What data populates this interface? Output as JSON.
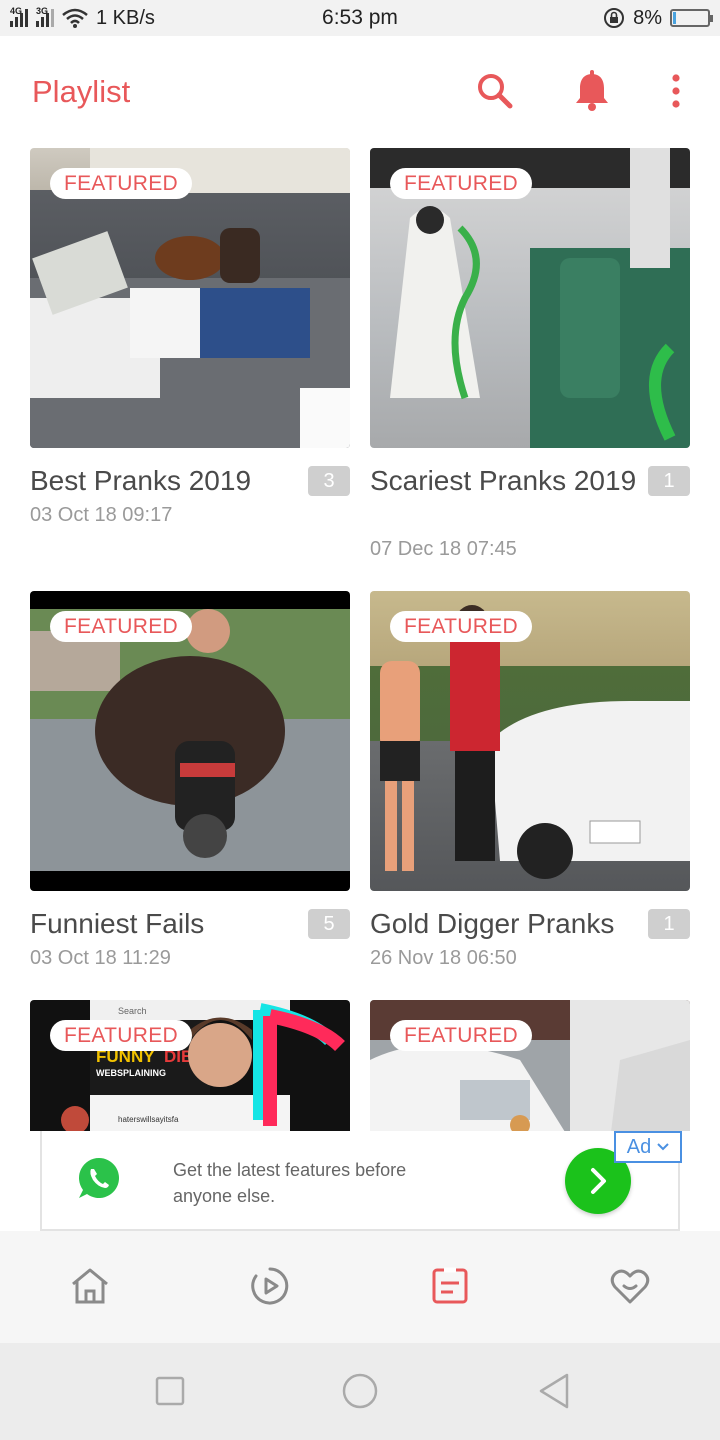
{
  "status_bar": {
    "network_1": "4G",
    "network_2": "3G",
    "speed": "1 KB/s",
    "time": "6:53 pm",
    "battery_percent": "8%",
    "battery_level": 0.08
  },
  "header": {
    "title": "Playlist",
    "search_icon": "search-icon",
    "bell_icon": "bell-icon",
    "more_icon": "more-vertical-icon",
    "accent_color": "#e8585a"
  },
  "playlists": [
    {
      "title": "Best Pranks 2019",
      "date": "03 Oct 18 09:17",
      "count": "3",
      "badge": "FEATURED"
    },
    {
      "title": "Scariest Pranks 2019",
      "date": "07 Dec 18 07:45",
      "count": "1",
      "badge": "FEATURED"
    },
    {
      "title": "Funniest Fails",
      "date": "03 Oct 18 11:29",
      "count": "5",
      "badge": "FEATURED"
    },
    {
      "title": "Gold Digger Pranks",
      "date": "26 Nov 18 06:50",
      "count": "1",
      "badge": "FEATURED"
    },
    {
      "badge": "FEATURED",
      "thumb_text_1": "Search",
      "thumb_text_2": "FUNNY",
      "thumb_text_3": "DIE",
      "thumb_text_4": "WEBSPLAINING",
      "thumb_text_5": "haterswillsayitsfa"
    },
    {
      "badge": "FEATURED"
    }
  ],
  "ad": {
    "text": "Get the latest features before anyone else.",
    "tag": "Ad",
    "icon": "whatsapp-icon",
    "cta_icon": "chevron-right-icon",
    "cta_color": "#1bc21b"
  },
  "bottom_nav": [
    {
      "name": "home",
      "icon": "home-icon",
      "active": false
    },
    {
      "name": "play",
      "icon": "play-circle-icon",
      "active": false
    },
    {
      "name": "playlist",
      "icon": "playlist-icon",
      "active": true
    },
    {
      "name": "favorites",
      "icon": "heart-icon",
      "active": false
    }
  ],
  "system_nav": [
    "recents-icon",
    "home-circle-icon",
    "back-icon"
  ]
}
